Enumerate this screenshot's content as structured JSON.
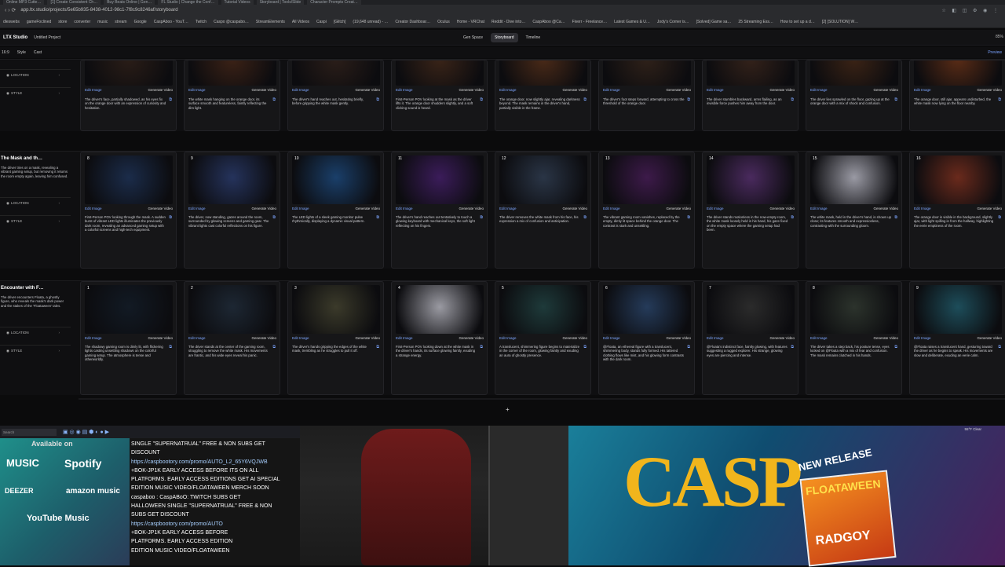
{
  "browser": {
    "tabs": [
      "Online MP3 Cutte…",
      "[1] Create Consistent Ch…",
      "Buy Beats Online | Gen…",
      "FL Studio | Change the Conf…",
      "Tutorial Videos",
      "Storyboard | Tools/Slide",
      "Character Prompts Creat…"
    ],
    "url": "app.ltx.studio/projects/5e65b935-8438-4012-98c1-7f8c9c8246af/storyboard",
    "bookmarks": [
      "dleswebs",
      "gameFoclined",
      "store",
      "converter",
      "music",
      "stream",
      "Google",
      "CaspAboo - YouT…",
      "Twitch",
      "Caspo @caspabo…",
      "StreamElements",
      "All Videos",
      "Caspi",
      "[Glitch]",
      "(19,648 unread) - …",
      "Creator Dashboar…",
      "Oculus",
      "Home - VRChat",
      "Reddit - Dive into…",
      "CaspAboo @Ca…",
      "Fiverr - Freelance…",
      "Latest Games & U…",
      "Jody's Corner is…",
      "[Solved] Game sa…",
      "25 Streaming Ess…",
      "How to set up a d…",
      "[2] [SOLUTION] W…"
    ]
  },
  "app": {
    "logo": "LTX Studio",
    "project_name": "Untitled Project",
    "nav": [
      "Gen Space",
      "Storyboard",
      "Timeline"
    ],
    "zoom": "85%",
    "sub_toolbar": {
      "page": "16:9",
      "style": "Style",
      "cast": "Cast",
      "preview": "Preview"
    }
  },
  "labels": {
    "location": "LOCATION",
    "style": "STYLE",
    "edit_image": "Edit Image",
    "generate_video": "Generate Video"
  },
  "scenes": [
    {
      "title": "",
      "description": "",
      "shots": [
        {
          "num": "",
          "desc": "The driver's face, partially shadowed, as his eyes fix on the orange door with an expression of curiosity and hesitation."
        },
        {
          "num": "",
          "desc": "The white mask hanging on the orange door, its surface smooth and featureless, faintly reflecting the dim light."
        },
        {
          "num": "",
          "desc": "The driver's hand reaches out, hesitating briefly, before gripping the white mask gently."
        },
        {
          "num": "",
          "desc": "First-Person POV looking at the mask as the driver lifts it. The orange door shudders slightly, and a soft clicking sound is heard."
        },
        {
          "num": "",
          "desc": "The orange door, now slightly ajar, revealing darkness beyond. The mask remains in the driver's hand, partially visible in the frame."
        },
        {
          "num": "",
          "desc": "The driver's foot steps forward, attempting to cross the threshold of the orange door."
        },
        {
          "num": "",
          "desc": "The driver stumbles backward, arms flailing, as an invisible force pushes him away from the door."
        },
        {
          "num": "",
          "desc": "The driver lies sprawled on the floor, gazing up at the orange door with a mix of shock and confusion."
        },
        {
          "num": "",
          "desc": "The orange door, still ajar, appears undisturbed, the white mask now lying on the floor nearby."
        }
      ]
    },
    {
      "title": "The Mask and th…",
      "description": "The driver tries on a mask, revealing a vibrant gaming setup, but removing it returns the room empty again, leaving him confused.",
      "shots": [
        {
          "num": "8",
          "desc": "First-Person POV looking through the mask. A sudden burst of vibrant LED lights illuminates the previously dark room, revealing an advanced gaming setup with a colorful screens and high-tech equipment."
        },
        {
          "num": "9",
          "desc": "The driver, now standing, gazes around the room, surrounded by glowing screens and gaming gear. The vibrant lights cast colorful reflections on his figure."
        },
        {
          "num": "10",
          "desc": "The LED lights of a sleek gaming monitor pulse rhythmically, displaying a dynamic visual pattern."
        },
        {
          "num": "11",
          "desc": "The driver's hand reaches out tentatively to touch a glowing keyboard with mechanical keys, the soft light reflecting on his fingers."
        },
        {
          "num": "12",
          "desc": "The driver removes the white mask from his face, his expression a mix of confusion and anticipation."
        },
        {
          "num": "13",
          "desc": "The vibrant gaming room vanishes, replaced by the empty, dimly lit space behind the orange door. The contrast is stark and unsettling."
        },
        {
          "num": "14",
          "desc": "The driver stands motionless in the now-empty room, the white mask loosely held in his hand, his gaze fixed on the empty space where the gaming setup had been."
        },
        {
          "num": "15",
          "desc": "The white mask, held in the driver's hand, is shown up close; its features smooth and expressionless, contrasting with the surrounding gloom."
        },
        {
          "num": "16",
          "desc": "The orange door is visible in the background, slightly ajar, with light spilling in from the hallway, highlighting the eerie emptiness of the room."
        }
      ]
    },
    {
      "title": "Encounter with F…",
      "description": "The driver encounters Floata, a ghostly figure, who reveals the mask's dark power and the stakes of the 'Floataween' tales.",
      "shots": [
        {
          "num": "1",
          "desc": "The shadowy gaming room is dimly lit, with flickering lights casting unsettling shadows on the colorful gaming setup. The atmosphere is tense and otherworldly."
        },
        {
          "num": "2",
          "desc": "The driver stands at the center of the gaming room, struggling to remove the white mask. His movements are frantic, and his wide eyes reveal his panic."
        },
        {
          "num": "3",
          "desc": "The driver's hands gripping the edges of the white mask, trembling as he struggles to pull it off."
        },
        {
          "num": "4",
          "desc": "First-Person POV looking down at the white mask in the driver's hands, its surface glowing faintly, exuding a strange energy."
        },
        {
          "num": "5",
          "desc": "A translucent, shimmering figure begins to materialize in the corner of the room, glowing faintly and exuding an aura of ghostly presence."
        },
        {
          "num": "6",
          "desc": "@Floata, an ethereal figure with a translucent, shimmering body, stands fully formed. His tattered clothing flows like mist, and his glowing form contrasts with the dark room."
        },
        {
          "num": "7",
          "desc": "@Floata's indistinct face, faintly glowing, with features suggesting a rugged explorer. His strange, glowing eyes are piercing and intense."
        },
        {
          "num": "8",
          "desc": "The driver takes a step back, his posture tense, eyes locked on @Floata with a mix of fear and confusion. The mask remains clutched in his hands."
        },
        {
          "num": "9",
          "desc": "@Floata raises a translucent hand, gesturing toward the driver as he begins to speak. His movements are slow and deliberate, exuding an eerie calm."
        }
      ]
    }
  ],
  "stream_overlay": {
    "taskbar_search": "Search",
    "music_platforms": [
      "Available on",
      "MUSIC",
      "Spotify",
      "DEEZER",
      "amazon music",
      "YouTube Music"
    ],
    "ticker_lines": [
      "SINGLE \"SUPERNATRUAL\" FREE & NON SUBS GET",
      "DISCOUNT",
      "https://caspbootory.com/promo/AUTO_L2_65Y6VQJWB",
      "+BOK-JP1K EARLY ACCESS BEFORE ITS ON ALL",
      "PLATFORMS. EARLY ACCESS EDITIONS GET AI SPECIAL",
      "EDITION MUSIC VIDEO/FLOATAWEEN MERCH SOON",
      "caspaboo : CaspABoO: TWITCH SUBS GET",
      "HALLOWEEN SINGLE \"SUPERNATRUAL\" FREE & NON",
      "SUBS GET DISCOUNT",
      "https://caspbootory.com/promo/AUTO",
      "+BOK-JP1K EARLY ACCESS BEFORE",
      "PLATFORMS. EARLY ACCESS EDITION",
      "EDITION MUSIC VIDEO/FLOATAWEEN"
    ],
    "art_title": "CASP",
    "new_release": "NEW RELEASE",
    "album_title": "FLOATAWEEN",
    "album_sub": "RADGOY",
    "tray": "55°F Clear"
  },
  "thumb_colors": {
    "top": [
      "#2a1d17",
      "#3c2216",
      "#2b1e19",
      "#3a2418",
      "#4a2a18",
      "#2f2119",
      "#34221a",
      "#3b2315",
      "#5a2c16"
    ],
    "mid": [
      "#1b2c4a",
      "#25335c",
      "#1a3f6a",
      "#3b1c5a",
      "#2a3546",
      "#3d1a4a",
      "#4a2a5e",
      "#9a9aa4",
      "#6a2a1c"
    ],
    "bot": [
      "#121a24",
      "#1d2733",
      "#3b3a2a",
      "#9a9aa2",
      "#1e3a3a",
      "#253b5a",
      "#2b2b2b",
      "#2c332c",
      "#1d4d5a"
    ]
  }
}
